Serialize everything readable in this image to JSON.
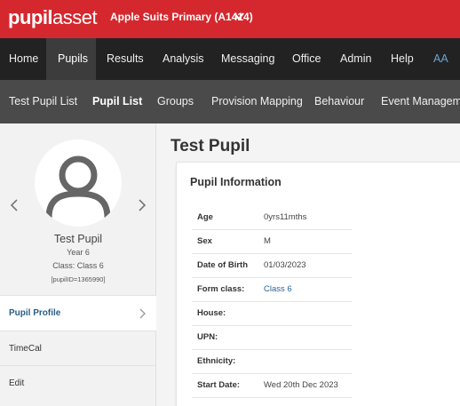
{
  "brand": {
    "logo_part1": "pupil",
    "logo_part2": "asset"
  },
  "school": {
    "name": "Apple Suits Primary (A1414)"
  },
  "main_nav": {
    "items": [
      {
        "label": "Home"
      },
      {
        "label": "Pupils"
      },
      {
        "label": "Results"
      },
      {
        "label": "Analysis"
      },
      {
        "label": "Messaging"
      },
      {
        "label": "Office"
      },
      {
        "label": "Admin"
      },
      {
        "label": "Help"
      }
    ],
    "user_initials": "AA",
    "active": "Pupils"
  },
  "sub_nav": {
    "items": [
      {
        "label": "Test Pupil List"
      },
      {
        "label": "Pupil List"
      },
      {
        "label": "Groups"
      },
      {
        "label": "Provision Mapping"
      },
      {
        "label": "Behaviour"
      },
      {
        "label": "Event Managemen"
      }
    ],
    "active": "Pupil List"
  },
  "pupil": {
    "name": "Test Pupil",
    "year": "Year 6",
    "class": "Class: Class 6",
    "pupil_id": "[pupilID=1365990]"
  },
  "side_menu": {
    "items": [
      {
        "label": "Pupil Profile"
      },
      {
        "label": "TimeCal"
      },
      {
        "label": "Edit"
      }
    ],
    "active": "Pupil Profile"
  },
  "page": {
    "title": "Test Pupil"
  },
  "pupil_info": {
    "heading": "Pupil Information",
    "rows": [
      {
        "label": "Age",
        "value": "0yrs11mths"
      },
      {
        "label": "Sex",
        "value": "M"
      },
      {
        "label": "Date of Birth",
        "value": "01/03/2023"
      },
      {
        "label": "Form class:",
        "value": "Class 6"
      },
      {
        "label": "House:",
        "value": ""
      },
      {
        "label": "UPN:",
        "value": ""
      },
      {
        "label": "Ethnicity:",
        "value": ""
      },
      {
        "label": "Start Date:",
        "value": "Wed 20th Dec 2023"
      }
    ]
  },
  "colors": {
    "brand_red": "#d4282e",
    "nav_dark": "#222222",
    "subnav": "#4a4a4a",
    "link_blue": "#2a6496"
  }
}
